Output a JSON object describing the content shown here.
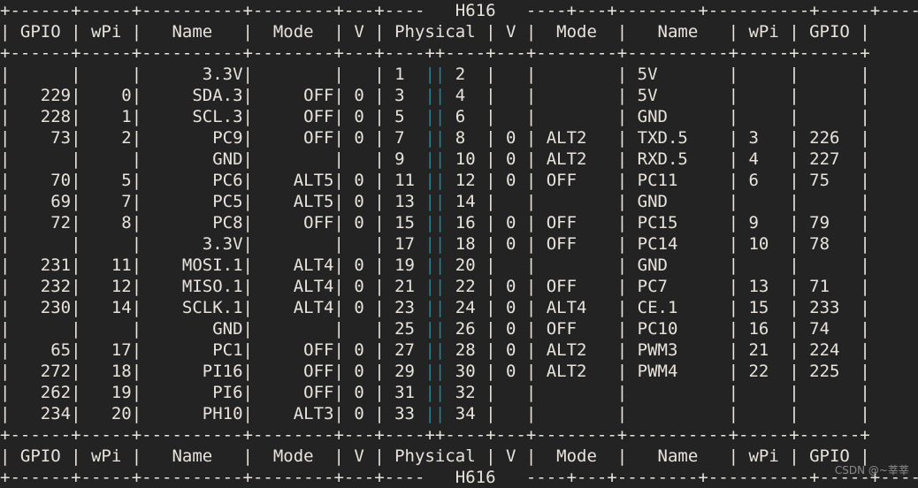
{
  "terminal": {
    "chip_title": "H616",
    "background": "#232323",
    "foreground": "#e8e4dd",
    "separator_color": "#2a7e96",
    "watermark": "CSDN @~莘莘"
  },
  "table": {
    "headers_left": [
      "GPIO",
      "wPi",
      "Name",
      "Mode",
      "V",
      "Physical"
    ],
    "headers_right": [
      "V",
      "Mode",
      "Name",
      "wPi",
      "GPIO"
    ],
    "headers_full": [
      "GPIO",
      "wPi",
      "Name",
      "Mode",
      "V",
      "Physical",
      "V",
      "Mode",
      "Name",
      "wPi",
      "GPIO"
    ],
    "rows": [
      {
        "gpio_l": "",
        "wpi_l": "",
        "name_l": "3.3V",
        "mode_l": "",
        "v_l": "",
        "phys_l": "1",
        "phys_r": "2",
        "v_r": "",
        "mode_r": "",
        "name_r": "5V",
        "wpi_r": "",
        "gpio_r": ""
      },
      {
        "gpio_l": "229",
        "wpi_l": "0",
        "name_l": "SDA.3",
        "mode_l": "OFF",
        "v_l": "0",
        "phys_l": "3",
        "phys_r": "4",
        "v_r": "",
        "mode_r": "",
        "name_r": "5V",
        "wpi_r": "",
        "gpio_r": ""
      },
      {
        "gpio_l": "228",
        "wpi_l": "1",
        "name_l": "SCL.3",
        "mode_l": "OFF",
        "v_l": "0",
        "phys_l": "5",
        "phys_r": "6",
        "v_r": "",
        "mode_r": "",
        "name_r": "GND",
        "wpi_r": "",
        "gpio_r": ""
      },
      {
        "gpio_l": "73",
        "wpi_l": "2",
        "name_l": "PC9",
        "mode_l": "OFF",
        "v_l": "0",
        "phys_l": "7",
        "phys_r": "8",
        "v_r": "0",
        "mode_r": "ALT2",
        "name_r": "TXD.5",
        "wpi_r": "3",
        "gpio_r": "226"
      },
      {
        "gpio_l": "",
        "wpi_l": "",
        "name_l": "GND",
        "mode_l": "",
        "v_l": "",
        "phys_l": "9",
        "phys_r": "10",
        "v_r": "0",
        "mode_r": "ALT2",
        "name_r": "RXD.5",
        "wpi_r": "4",
        "gpio_r": "227"
      },
      {
        "gpio_l": "70",
        "wpi_l": "5",
        "name_l": "PC6",
        "mode_l": "ALT5",
        "v_l": "0",
        "phys_l": "11",
        "phys_r": "12",
        "v_r": "0",
        "mode_r": "OFF",
        "name_r": "PC11",
        "wpi_r": "6",
        "gpio_r": "75"
      },
      {
        "gpio_l": "69",
        "wpi_l": "7",
        "name_l": "PC5",
        "mode_l": "ALT5",
        "v_l": "0",
        "phys_l": "13",
        "phys_r": "14",
        "v_r": "",
        "mode_r": "",
        "name_r": "GND",
        "wpi_r": "",
        "gpio_r": ""
      },
      {
        "gpio_l": "72",
        "wpi_l": "8",
        "name_l": "PC8",
        "mode_l": "OFF",
        "v_l": "0",
        "phys_l": "15",
        "phys_r": "16",
        "v_r": "0",
        "mode_r": "OFF",
        "name_r": "PC15",
        "wpi_r": "9",
        "gpio_r": "79"
      },
      {
        "gpio_l": "",
        "wpi_l": "",
        "name_l": "3.3V",
        "mode_l": "",
        "v_l": "",
        "phys_l": "17",
        "phys_r": "18",
        "v_r": "0",
        "mode_r": "OFF",
        "name_r": "PC14",
        "wpi_r": "10",
        "gpio_r": "78"
      },
      {
        "gpio_l": "231",
        "wpi_l": "11",
        "name_l": "MOSI.1",
        "mode_l": "ALT4",
        "v_l": "0",
        "phys_l": "19",
        "phys_r": "20",
        "v_r": "",
        "mode_r": "",
        "name_r": "GND",
        "wpi_r": "",
        "gpio_r": ""
      },
      {
        "gpio_l": "232",
        "wpi_l": "12",
        "name_l": "MISO.1",
        "mode_l": "ALT4",
        "v_l": "0",
        "phys_l": "21",
        "phys_r": "22",
        "v_r": "0",
        "mode_r": "OFF",
        "name_r": "PC7",
        "wpi_r": "13",
        "gpio_r": "71"
      },
      {
        "gpio_l": "230",
        "wpi_l": "14",
        "name_l": "SCLK.1",
        "mode_l": "ALT4",
        "v_l": "0",
        "phys_l": "23",
        "phys_r": "24",
        "v_r": "0",
        "mode_r": "ALT4",
        "name_r": "CE.1",
        "wpi_r": "15",
        "gpio_r": "233"
      },
      {
        "gpio_l": "",
        "wpi_l": "",
        "name_l": "GND",
        "mode_l": "",
        "v_l": "",
        "phys_l": "25",
        "phys_r": "26",
        "v_r": "0",
        "mode_r": "OFF",
        "name_r": "PC10",
        "wpi_r": "16",
        "gpio_r": "74"
      },
      {
        "gpio_l": "65",
        "wpi_l": "17",
        "name_l": "PC1",
        "mode_l": "OFF",
        "v_l": "0",
        "phys_l": "27",
        "phys_r": "28",
        "v_r": "0",
        "mode_r": "ALT2",
        "name_r": "PWM3",
        "wpi_r": "21",
        "gpio_r": "224"
      },
      {
        "gpio_l": "272",
        "wpi_l": "18",
        "name_l": "PI16",
        "mode_l": "OFF",
        "v_l": "0",
        "phys_l": "29",
        "phys_r": "30",
        "v_r": "0",
        "mode_r": "ALT2",
        "name_r": "PWM4",
        "wpi_r": "22",
        "gpio_r": "225"
      },
      {
        "gpio_l": "262",
        "wpi_l": "19",
        "name_l": "PI6",
        "mode_l": "OFF",
        "v_l": "0",
        "phys_l": "31",
        "phys_r": "32",
        "v_r": "",
        "mode_r": "",
        "name_r": "",
        "wpi_r": "",
        "gpio_r": ""
      },
      {
        "gpio_l": "234",
        "wpi_l": "20",
        "name_l": "PH10",
        "mode_l": "ALT3",
        "v_l": "0",
        "phys_l": "33",
        "phys_r": "34",
        "v_r": "",
        "mode_r": "",
        "name_r": "",
        "wpi_r": "",
        "gpio_r": ""
      }
    ]
  }
}
